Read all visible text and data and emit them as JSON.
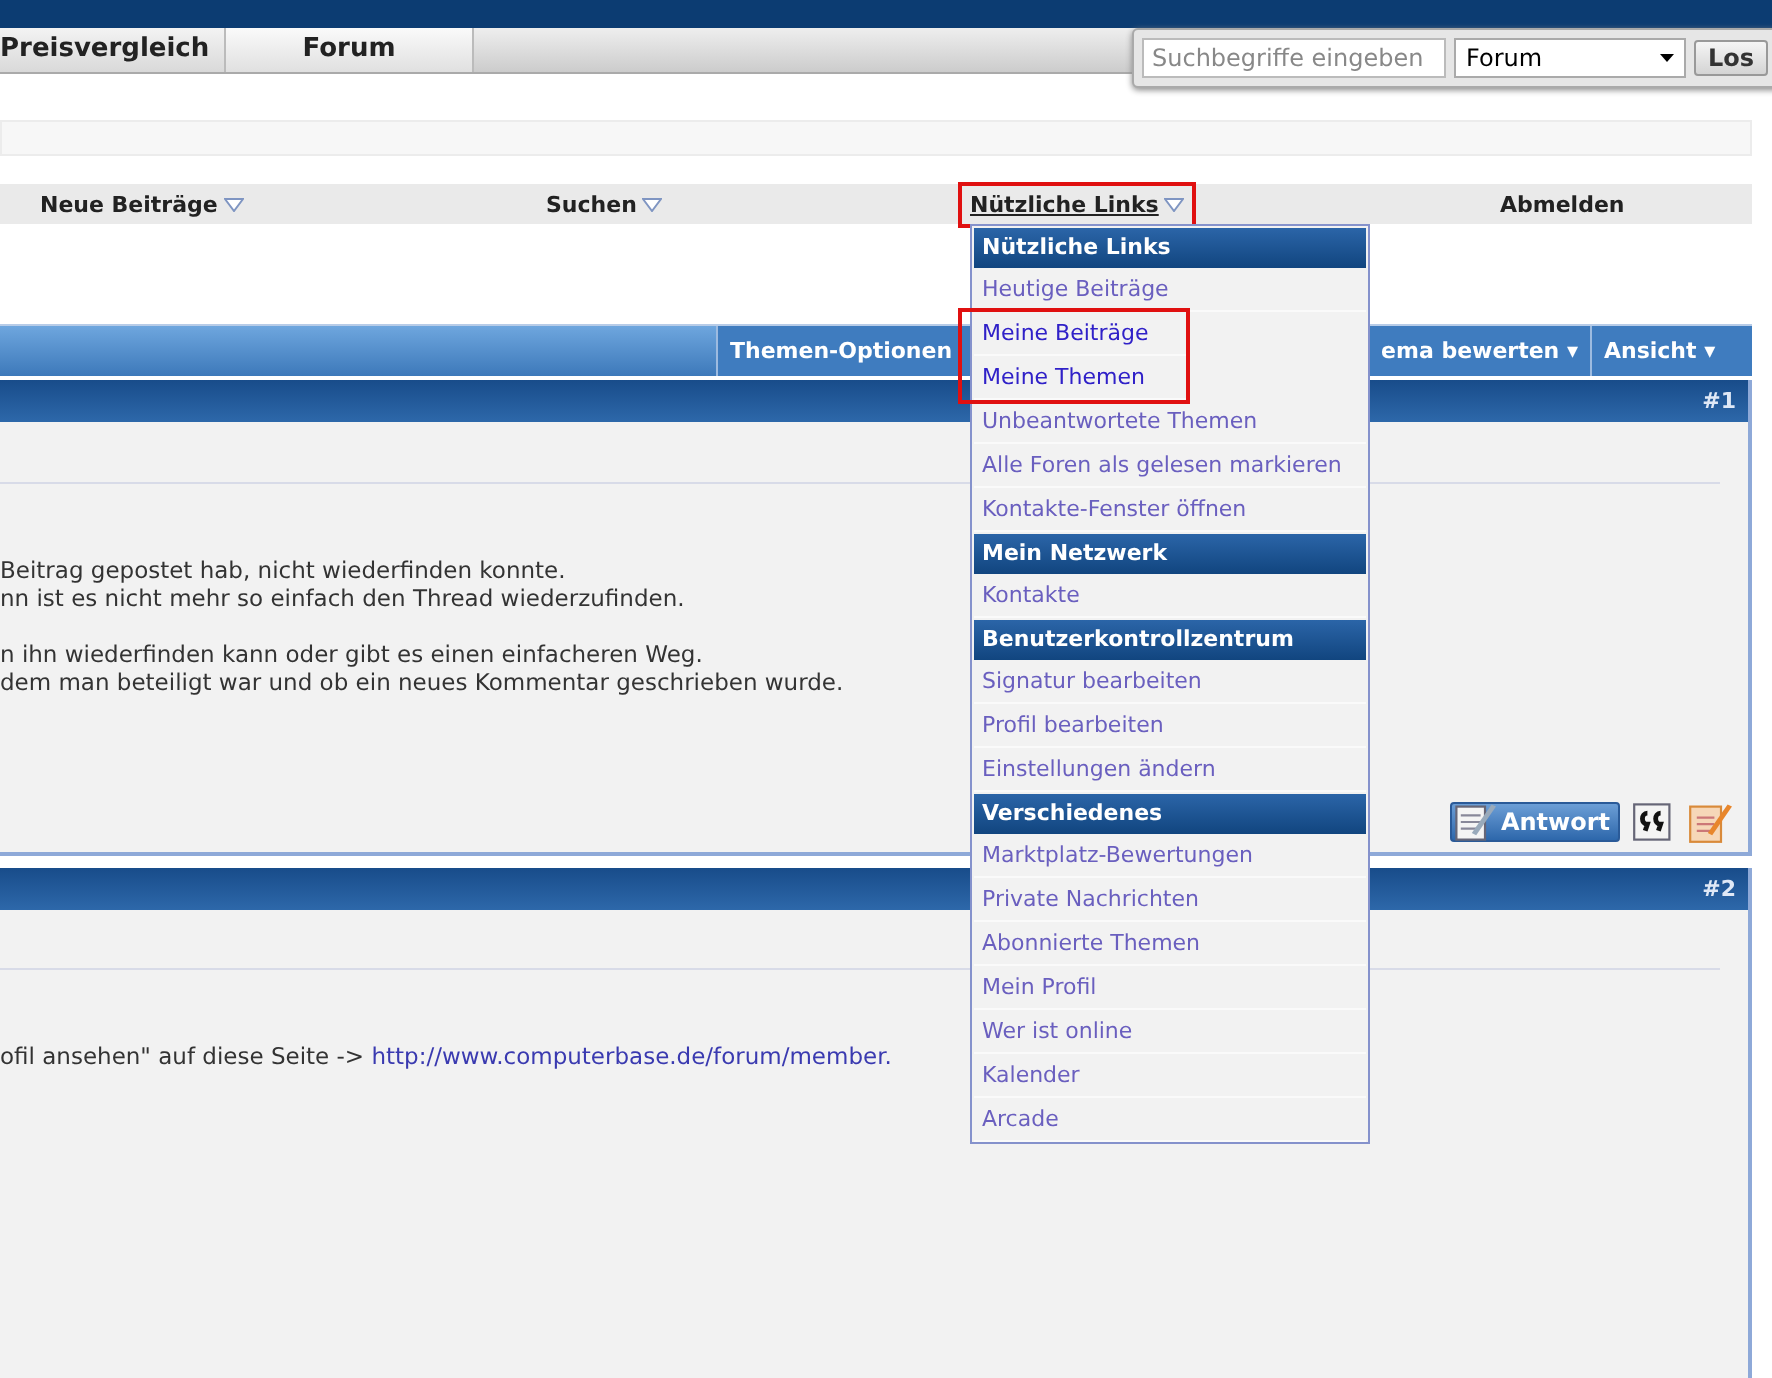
{
  "tabs": [
    {
      "label": "Preisvergleich",
      "selected": false
    },
    {
      "label": "Forum",
      "selected": true
    }
  ],
  "search": {
    "placeholder": "Suchbegriffe eingeben",
    "scope": "Forum",
    "button": "Los"
  },
  "nav": [
    {
      "label": "Neue Beiträge",
      "has_menu": true,
      "annotated": false,
      "open": false
    },
    {
      "label": "Suchen",
      "has_menu": true,
      "annotated": false,
      "open": false
    },
    {
      "label": "Nützliche Links",
      "has_menu": true,
      "annotated": true,
      "open": true
    },
    {
      "label": "Abmelden",
      "has_menu": false,
      "annotated": false,
      "open": false
    }
  ],
  "thread_options": [
    "Themen-Optionen",
    "ema bewerten ▾",
    "Ansicht ▾"
  ],
  "posts": [
    {
      "number": "#1",
      "paragraphs": [
        [
          "Beitrag gepostet hab, nicht wiederfinden konnte.",
          "nn ist es nicht mehr so einfach den Thread wiederzufinden."
        ],
        [
          "n ihn wiederfinden kann oder gibt es einen einfacheren Weg.",
          " dem man beteiligt war und ob ein neues Kommentar geschrieben wurde."
        ]
      ],
      "reply_button": "Antwort"
    },
    {
      "number": "#2",
      "paragraphs": [
        [
          "ofil ansehen\" auf diese Seite -> "
        ]
      ],
      "link": "http://www.computerbase.de/forum/member."
    }
  ],
  "menu": [
    {
      "kind": "header",
      "label": "Nützliche Links"
    },
    {
      "kind": "item",
      "label": "Heutige Beiträge",
      "annotated": false
    },
    {
      "kind": "item",
      "label": "Meine Beiträge",
      "annotated": true
    },
    {
      "kind": "item",
      "label": "Meine Themen",
      "annotated": true
    },
    {
      "kind": "item",
      "label": "Unbeantwortete Themen",
      "annotated": false
    },
    {
      "kind": "item",
      "label": "Alle Foren als gelesen markieren",
      "annotated": false
    },
    {
      "kind": "item",
      "label": "Kontakte-Fenster öffnen",
      "annotated": false
    },
    {
      "kind": "header",
      "label": "Mein Netzwerk"
    },
    {
      "kind": "item",
      "label": "Kontakte",
      "annotated": false
    },
    {
      "kind": "header",
      "label": "Benutzerkontrollzentrum"
    },
    {
      "kind": "item",
      "label": "Signatur bearbeiten",
      "annotated": false
    },
    {
      "kind": "item",
      "label": "Profil bearbeiten",
      "annotated": false
    },
    {
      "kind": "item",
      "label": "Einstellungen ändern",
      "annotated": false
    },
    {
      "kind": "header",
      "label": "Verschiedenes"
    },
    {
      "kind": "item",
      "label": "Marktplatz-Bewertungen",
      "annotated": false
    },
    {
      "kind": "item",
      "label": "Private Nachrichten",
      "annotated": false
    },
    {
      "kind": "item",
      "label": "Abonnierte Themen",
      "annotated": false
    },
    {
      "kind": "item",
      "label": "Mein Profil",
      "annotated": false
    },
    {
      "kind": "item",
      "label": "Wer ist online",
      "annotated": false
    },
    {
      "kind": "item",
      "label": "Kalender",
      "annotated": false
    },
    {
      "kind": "item",
      "label": "Arcade",
      "annotated": false
    }
  ]
}
